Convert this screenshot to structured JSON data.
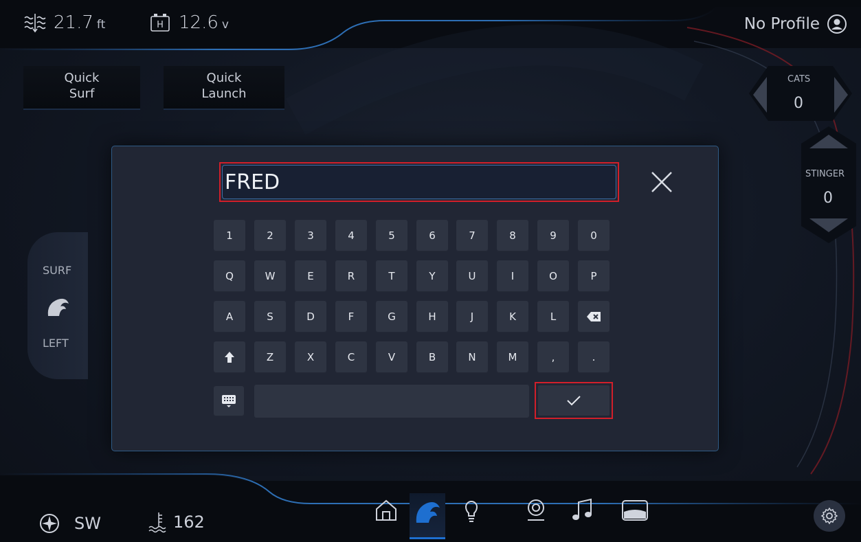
{
  "top_bar": {
    "depth_value": "21.7",
    "depth_unit": "ft",
    "battery_value": "12.6",
    "battery_unit": "v",
    "profile_label": "No Profile"
  },
  "quick_buttons": {
    "surf": [
      "Quick",
      "Surf"
    ],
    "launch": [
      "Quick",
      "Launch"
    ]
  },
  "right_controls": {
    "cats_label": "CATS",
    "cats_value": "0",
    "stinger_label": "STINGER",
    "stinger_value": "0"
  },
  "surf_panel": {
    "top_label": "SURF",
    "bottom_label": "LEFT"
  },
  "keyboard": {
    "input_value": "FRED",
    "rows": [
      [
        "1",
        "2",
        "3",
        "4",
        "5",
        "6",
        "7",
        "8",
        "9",
        "0"
      ],
      [
        "Q",
        "W",
        "E",
        "R",
        "T",
        "Y",
        "U",
        "I",
        "O",
        "P"
      ],
      [
        "A",
        "S",
        "D",
        "F",
        "G",
        "H",
        "J",
        "K",
        "L",
        "backspace"
      ],
      [
        "shift",
        "Z",
        "X",
        "C",
        "V",
        "B",
        "N",
        "M",
        ",",
        "."
      ]
    ]
  },
  "bottom_bar": {
    "heading": "SW",
    "water_temp": "162",
    "nav_icons": [
      "home-icon",
      "wave-icon",
      "bulb-icon",
      "camera-icon",
      "music-note-icon",
      "tank-icon"
    ],
    "active_nav": "wave-icon"
  },
  "colors": {
    "accent_blue": "#1e6fd0",
    "highlight_red": "#d21f2a",
    "modal_bg": "#212634",
    "key_bg": "#2e3442"
  }
}
